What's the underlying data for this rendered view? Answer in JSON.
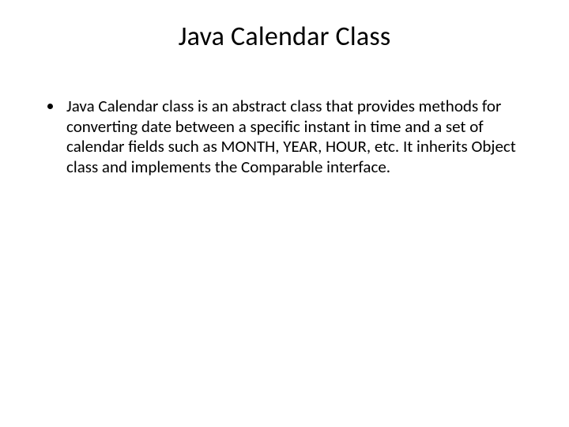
{
  "slide": {
    "title": "Java Calendar Class",
    "bullets": [
      "Java Calendar class is an abstract class that provides methods for converting date between a specific instant in time and a set of calendar fields such as MONTH, YEAR, HOUR, etc. It inherits Object class and implements the Comparable interface."
    ]
  }
}
